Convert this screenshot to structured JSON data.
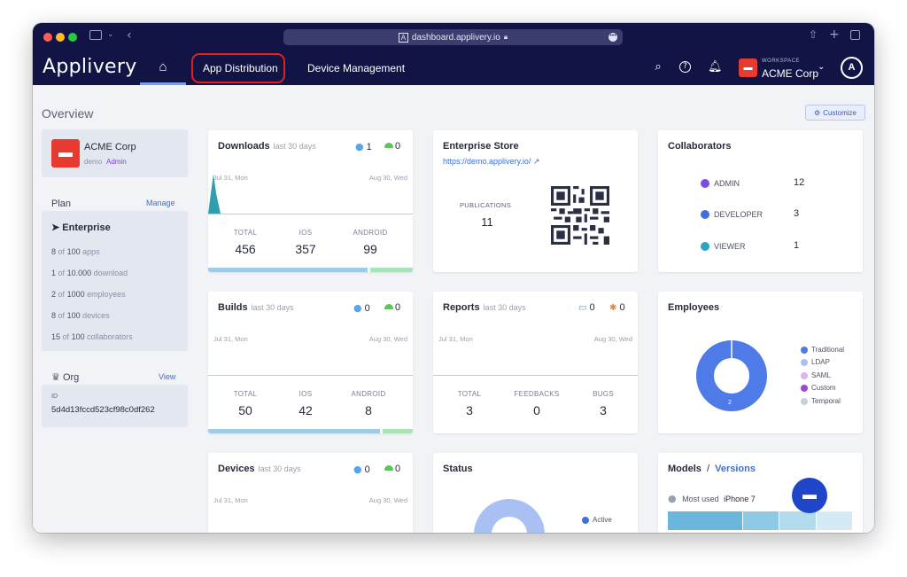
{
  "browser": {
    "url": "dashboard.applivery.io",
    "icons": [
      "sidebar-icon",
      "chevron-down-icon",
      "back-icon",
      "share-icon",
      "new-tab-icon",
      "tabs-icon"
    ]
  },
  "nav": {
    "logo": "Applivery",
    "home_icon": "home-icon",
    "links": [
      "App Distribution",
      "Device Management"
    ],
    "highlight_color": "#e02020",
    "workspace_label": "WORKSPACE",
    "workspace_name": "ACME Corp",
    "avatar_letter": "A"
  },
  "page": {
    "title": "Overview",
    "customize_label": "Customize"
  },
  "company": {
    "name": "ACME Corp",
    "role": "demo",
    "badge": "Admin"
  },
  "plan": {
    "heading": "Plan",
    "manage_label": "Manage",
    "name": "Enterprise",
    "rows": [
      {
        "used": "8",
        "of": "of",
        "limit": "100",
        "unit": "apps"
      },
      {
        "used": "1",
        "of": "of",
        "limit": "10.000",
        "unit": "download"
      },
      {
        "used": "2",
        "of": "of",
        "limit": "1000",
        "unit": "employees"
      },
      {
        "used": "8",
        "of": "of",
        "limit": "100",
        "unit": "devices"
      },
      {
        "used": "15",
        "of": "of",
        "limit": "100",
        "unit": "collaborators"
      }
    ]
  },
  "org": {
    "heading": "Org",
    "view_label": "View",
    "id_label": "ID",
    "id_value": "5d4d13fccd523cf98c0df262"
  },
  "downloads": {
    "title": "Downloads",
    "period": "last 30 days",
    "ios_count": "1",
    "android_count": "0",
    "date_start": "Jul 31, Mon",
    "date_end": "Aug 30, Wed",
    "total_label": "TOTAL",
    "total": "456",
    "ios_label": "IOS",
    "ios": "357",
    "android_label": "ANDROID",
    "android": "99",
    "ios_fraction": 0.78
  },
  "store": {
    "title": "Enterprise Store",
    "url": "https://demo.applivery.io/",
    "publications_label": "PUBLICATIONS",
    "publications": "11"
  },
  "collaborators": {
    "title": "Collaborators",
    "roles": [
      {
        "label": "ADMIN",
        "value": "12",
        "color": "#7a4ee0"
      },
      {
        "label": "DEVELOPER",
        "value": "3",
        "color": "#3f6fe0"
      },
      {
        "label": "VIEWER",
        "value": "1",
        "color": "#2aa6c4"
      }
    ]
  },
  "builds": {
    "title": "Builds",
    "period": "last 30 days",
    "ios_count": "0",
    "android_count": "0",
    "date_start": "Jul 31, Mon",
    "date_end": "Aug 30, Wed",
    "total_label": "TOTAL",
    "total": "50",
    "ios_label": "IOS",
    "ios": "42",
    "android_label": "ANDROID",
    "android": "8",
    "ios_fraction": 0.84
  },
  "reports": {
    "title": "Reports",
    "period": "last 30 days",
    "feedback_count": "0",
    "bug_count": "0",
    "date_start": "Jul 31, Mon",
    "date_end": "Aug 30, Wed",
    "total_label": "TOTAL",
    "total": "3",
    "feedbacks_label": "FEEDBACKS",
    "feedbacks": "0",
    "bugs_label": "BUGS",
    "bugs": "3"
  },
  "employees": {
    "title": "Employees",
    "donut_value": "2",
    "legend": [
      {
        "label": "Traditional",
        "color": "#4f7be8"
      },
      {
        "label": "LDAP",
        "color": "#a9c1f2"
      },
      {
        "label": "SAML",
        "color": "#d8b6f0"
      },
      {
        "label": "Custom",
        "color": "#9a48d8"
      },
      {
        "label": "Temporal",
        "color": "#c8d0dc"
      }
    ]
  },
  "devices": {
    "title": "Devices",
    "period": "last 30 days",
    "ios_count": "0",
    "android_count": "0",
    "date_start": "Jul 31, Mon",
    "date_end": "Aug 30, Wed"
  },
  "status": {
    "title": "Status",
    "legend_active": "Active"
  },
  "models": {
    "title": "Models",
    "separator": "/",
    "versions_link": "Versions",
    "most_used_label": "Most used",
    "most_used_value": "iPhone 7"
  }
}
